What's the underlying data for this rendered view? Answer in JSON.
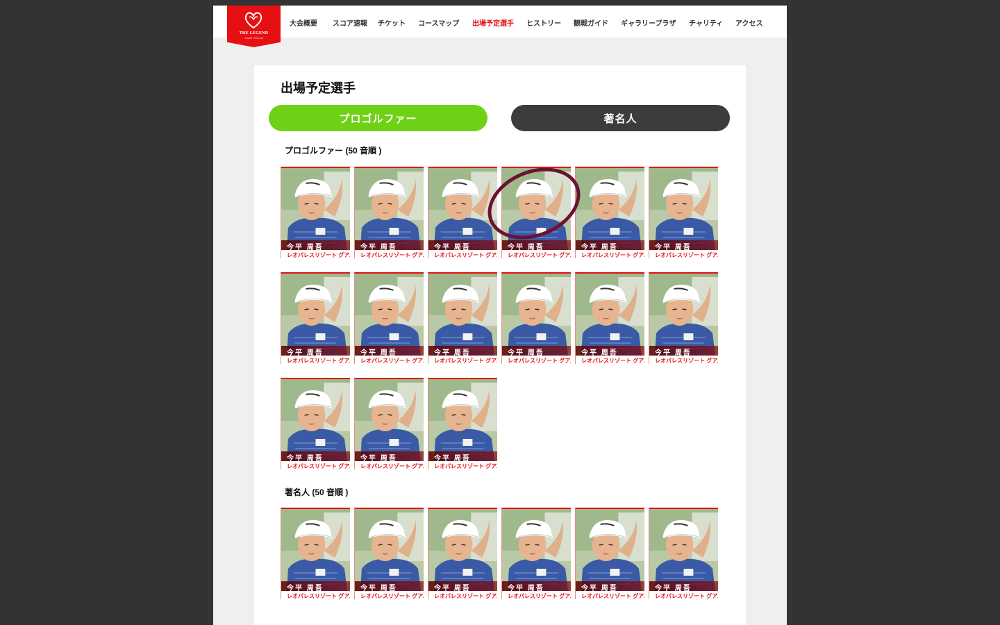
{
  "brand": {
    "logo_text": "THE LEGEND",
    "logo_sub": "CHARITY PRO-AM"
  },
  "nav": [
    {
      "label": "大会概要",
      "active": false
    },
    {
      "label": "スコア速報",
      "active": false
    },
    {
      "label": "チケット",
      "active": false
    },
    {
      "label": "コースマップ",
      "active": false
    },
    {
      "label": "出場予定選手",
      "active": true
    },
    {
      "label": "ヒストリー",
      "active": false
    },
    {
      "label": "観戦ガイド",
      "active": false
    },
    {
      "label": "ギャラリープラザ",
      "active": false
    },
    {
      "label": "チャリティ",
      "active": false
    },
    {
      "label": "アクセス",
      "active": false
    }
  ],
  "page_title": "出場予定選手",
  "tabs": {
    "pro": "プロゴルファー",
    "celebrity": "著名人"
  },
  "sections": {
    "pro_label": "プロゴルファー (50 音順 )",
    "celebrity_label": "著名人 (50 音順 )"
  },
  "players": [
    {
      "name": "今平 周吾",
      "affiliation": "レオパレスリゾート グアム"
    },
    {
      "name": "今平 周吾",
      "affiliation": "レオパレスリゾート グアム"
    },
    {
      "name": "今平 周吾",
      "affiliation": "レオパレスリゾート グアム"
    },
    {
      "name": "今平 周吾",
      "affiliation": "レオパレスリゾート グアム"
    },
    {
      "name": "今平 周吾",
      "affiliation": "レオパレスリゾート グアム"
    },
    {
      "name": "今平 周吾",
      "affiliation": "レオパレスリゾート グアム"
    },
    {
      "name": "今平 周吾",
      "affiliation": "レオパレスリゾート グアム"
    },
    {
      "name": "今平 周吾",
      "affiliation": "レオパレスリゾート グアム"
    },
    {
      "name": "今平 周吾",
      "affiliation": "レオパレスリゾート グアム"
    },
    {
      "name": "今平 周吾",
      "affiliation": "レオパレスリゾート グアム"
    },
    {
      "name": "今平 周吾",
      "affiliation": "レオパレスリゾート グアム"
    },
    {
      "name": "今平 周吾",
      "affiliation": "レオパレスリゾート グアム"
    },
    {
      "name": "今平 周吾",
      "affiliation": "レオパレスリゾート グアム"
    },
    {
      "name": "今平 周吾",
      "affiliation": "レオパレスリゾート グアム"
    },
    {
      "name": "今平 周吾",
      "affiliation": "レオパレスリゾート グアム"
    }
  ],
  "celebrities": [
    {
      "name": "今平 周吾",
      "affiliation": "レオパレスリゾート グアム"
    },
    {
      "name": "今平 周吾",
      "affiliation": "レオパレスリゾート グアム"
    },
    {
      "name": "今平 周吾",
      "affiliation": "レオパレスリゾート グアム"
    },
    {
      "name": "今平 周吾",
      "affiliation": "レオパレスリゾート グアム"
    },
    {
      "name": "今平 周吾",
      "affiliation": "レオパレスリゾート グアム"
    },
    {
      "name": "今平 周吾",
      "affiliation": "レオパレスリゾート グアム"
    }
  ],
  "colors": {
    "brand_red": "#e60f12",
    "tab_active": "#6fd116",
    "tab_inactive": "#3c3c3c",
    "highlight_ring": "#6d1130"
  }
}
